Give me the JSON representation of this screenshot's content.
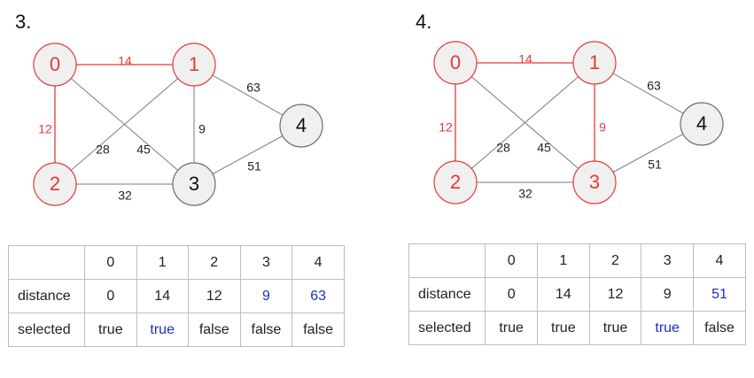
{
  "colors": {
    "selected": "#e53935",
    "selected_fill": "#f0f0f0",
    "unselected_stroke": "#6b6b6b",
    "unselected_text": "#111111",
    "edge": "#7a7a7a",
    "weight_text": "#222222",
    "highlight": "#1e2ec4"
  },
  "panels": [
    {
      "step_label": "3.",
      "nodes": [
        {
          "id": "0",
          "selected": true
        },
        {
          "id": "1",
          "selected": true
        },
        {
          "id": "2",
          "selected": true
        },
        {
          "id": "3",
          "selected": false
        },
        {
          "id": "4",
          "selected": false
        }
      ],
      "edges": [
        {
          "from": "0",
          "to": "1",
          "weight": "14",
          "tree": true
        },
        {
          "from": "0",
          "to": "2",
          "weight": "12",
          "tree": true
        },
        {
          "from": "0",
          "to": "3",
          "weight": "45",
          "tree": false
        },
        {
          "from": "1",
          "to": "2",
          "weight": "28",
          "tree": false
        },
        {
          "from": "1",
          "to": "3",
          "weight": "9",
          "tree": false
        },
        {
          "from": "1",
          "to": "4",
          "weight": "63",
          "tree": false
        },
        {
          "from": "2",
          "to": "3",
          "weight": "32",
          "tree": false
        },
        {
          "from": "3",
          "to": "4",
          "weight": "51",
          "tree": false
        }
      ],
      "table": {
        "headers": [
          "",
          "0",
          "1",
          "2",
          "3",
          "4"
        ],
        "rows": [
          {
            "label": "distance",
            "cells": [
              {
                "text": "0",
                "highlight": false
              },
              {
                "text": "14",
                "highlight": false
              },
              {
                "text": "12",
                "highlight": false
              },
              {
                "text": "9",
                "highlight": true
              },
              {
                "text": "63",
                "highlight": true
              }
            ]
          },
          {
            "label": "selected",
            "cells": [
              {
                "text": "true",
                "highlight": false
              },
              {
                "text": "true",
                "highlight": true
              },
              {
                "text": "false",
                "highlight": false
              },
              {
                "text": "false",
                "highlight": false
              },
              {
                "text": "false",
                "highlight": false
              }
            ]
          }
        ]
      }
    },
    {
      "step_label": "4.",
      "nodes": [
        {
          "id": "0",
          "selected": true
        },
        {
          "id": "1",
          "selected": true
        },
        {
          "id": "2",
          "selected": true
        },
        {
          "id": "3",
          "selected": true
        },
        {
          "id": "4",
          "selected": false
        }
      ],
      "edges": [
        {
          "from": "0",
          "to": "1",
          "weight": "14",
          "tree": true
        },
        {
          "from": "0",
          "to": "2",
          "weight": "12",
          "tree": true
        },
        {
          "from": "0",
          "to": "3",
          "weight": "45",
          "tree": false
        },
        {
          "from": "1",
          "to": "2",
          "weight": "28",
          "tree": false
        },
        {
          "from": "1",
          "to": "3",
          "weight": "9",
          "tree": true
        },
        {
          "from": "1",
          "to": "4",
          "weight": "63",
          "tree": false
        },
        {
          "from": "2",
          "to": "3",
          "weight": "32",
          "tree": false
        },
        {
          "from": "3",
          "to": "4",
          "weight": "51",
          "tree": false
        }
      ],
      "table": {
        "headers": [
          "",
          "0",
          "1",
          "2",
          "3",
          "4"
        ],
        "rows": [
          {
            "label": "distance",
            "cells": [
              {
                "text": "0",
                "highlight": false
              },
              {
                "text": "14",
                "highlight": false
              },
              {
                "text": "12",
                "highlight": false
              },
              {
                "text": "9",
                "highlight": false
              },
              {
                "text": "51",
                "highlight": true
              }
            ]
          },
          {
            "label": "selected",
            "cells": [
              {
                "text": "true",
                "highlight": false
              },
              {
                "text": "true",
                "highlight": false
              },
              {
                "text": "true",
                "highlight": false
              },
              {
                "text": "true",
                "highlight": true
              },
              {
                "text": "false",
                "highlight": false
              }
            ]
          }
        ]
      }
    }
  ]
}
